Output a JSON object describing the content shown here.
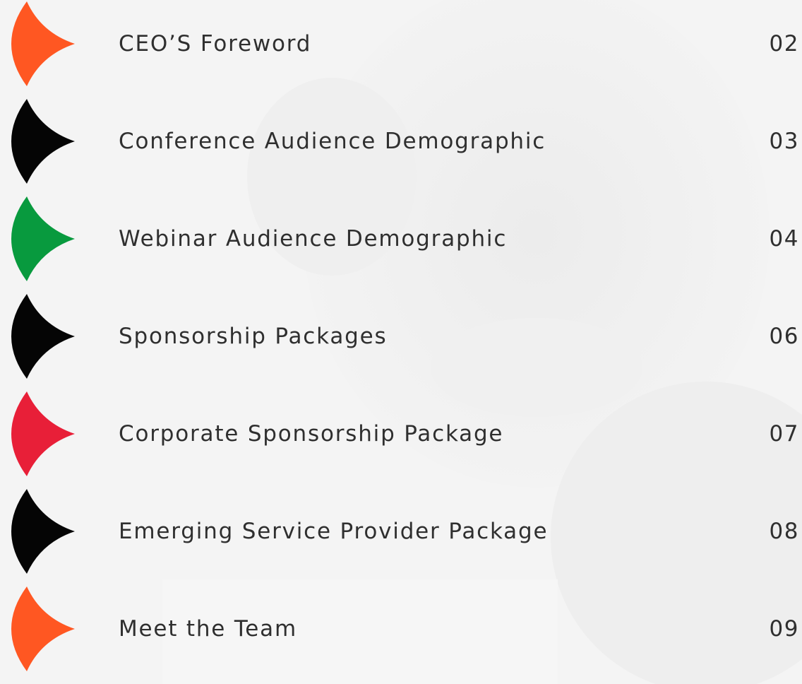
{
  "toc": {
    "items": [
      {
        "label": "CEO’S Foreword",
        "page": "02",
        "color": "#ff5722"
      },
      {
        "label": "Conference Audience Demographic",
        "page": "03",
        "color": "#050505"
      },
      {
        "label": "Webinar Audience Demographic",
        "page": "04",
        "color": "#089a3e"
      },
      {
        "label": "Sponsorship Packages",
        "page": "06",
        "color": "#050505"
      },
      {
        "label": "Corporate Sponsorship Package",
        "page": "07",
        "color": "#e81f38"
      },
      {
        "label": "Emerging Service Provider Package",
        "page": "08",
        "color": "#050505"
      },
      {
        "label": "Meet the Team",
        "page": "09",
        "color": "#ff5722"
      }
    ]
  }
}
